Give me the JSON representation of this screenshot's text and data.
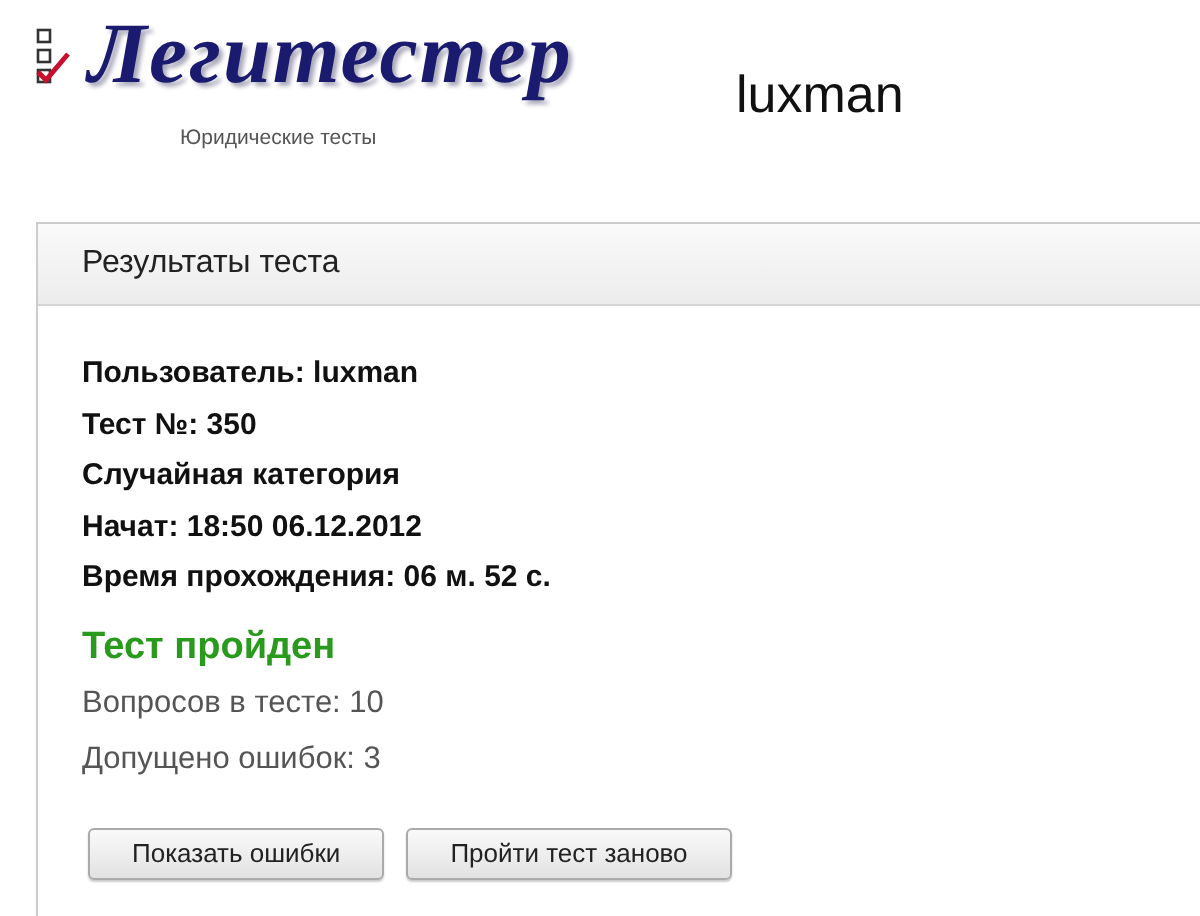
{
  "header": {
    "logo": "Легитестер",
    "tagline": "Юридические тесты",
    "username": "luxman"
  },
  "panel": {
    "title": "Результаты теста",
    "details": [
      "Пользователь: luxman",
      "Тест №: 350",
      "Случайная категория",
      "Начат: 18:50 06.12.2012",
      "Время прохождения: 06 м. 52 с."
    ],
    "status": {
      "text": "Тест пройден",
      "passed": true
    },
    "stats": [
      "Вопросов в тесте: 10",
      "Допущено ошибок: 3"
    ],
    "buttons": [
      "Показать ошибки",
      "Пройти тест заново"
    ]
  }
}
